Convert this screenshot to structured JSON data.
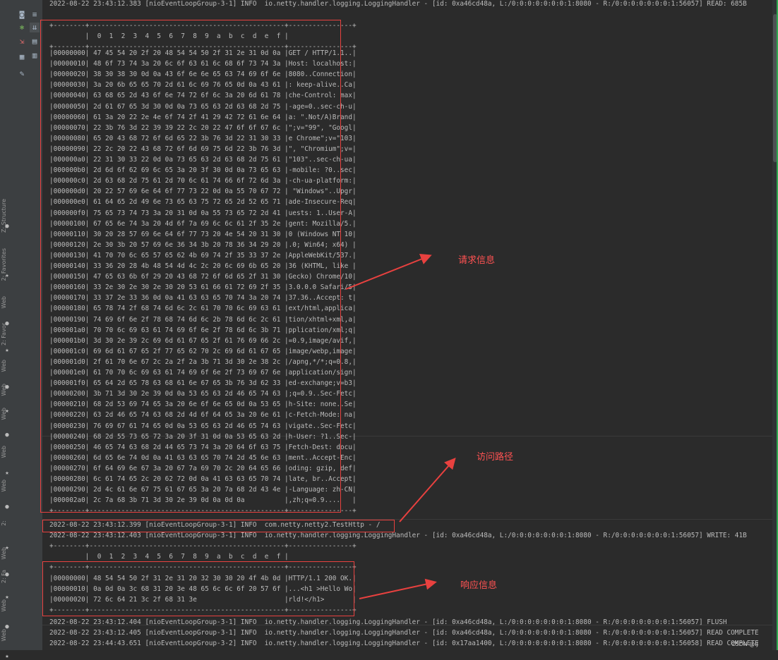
{
  "sidebar": {
    "tabs": [
      {
        "label": "Z: Structure"
      },
      {
        "label": "2: Favorites"
      },
      {
        "label": "Web"
      },
      {
        "label": "2: Favor"
      },
      {
        "label": "Web"
      },
      {
        "label": "Web"
      },
      {
        "label": "Web"
      },
      {
        "label": "Web"
      },
      {
        "label": "Web"
      },
      {
        "label": "2:"
      },
      {
        "label": "Web"
      },
      {
        "label": "2: Fa"
      },
      {
        "label": "Web"
      },
      {
        "label": "Web"
      }
    ]
  },
  "toolbar": {
    "icons": [
      "camera-icon",
      "wrap-icon",
      "settings-icon",
      "scroll-end-icon",
      "import-icon",
      "print-icon",
      "layout-icon",
      "trash-icon",
      "pin-icon"
    ]
  },
  "console": {
    "top_log": "2022-08-22 23:43:12.383 [nioEventLoopGroup-3-1] INFO  io.netty.handler.logging.LoggingHandler - [id: 0xa46cd48a, L:/0:0:0:0:0:0:0:1:8080 - R:/0:0:0:0:0:0:0:1:56057] READ: 685B",
    "hex_header": "         |  0  1  2  3  4  5  6  7  8  9  a  b  c  d  e  f |",
    "hex_border": "+--------+-------------------------------------------------+----------------+",
    "request_rows": [
      "|00000000| 47 45 54 20 2f 20 48 54 54 50 2f 31 2e 31 0d 0a |GET / HTTP/1.1..|",
      "|00000010| 48 6f 73 74 3a 20 6c 6f 63 61 6c 68 6f 73 74 3a |Host: localhost:|",
      "|00000020| 38 30 38 30 0d 0a 43 6f 6e 6e 65 63 74 69 6f 6e |8080..Connection|",
      "|00000030| 3a 20 6b 65 65 70 2d 61 6c 69 76 65 0d 0a 43 61 |: keep-alive..Ca|",
      "|00000040| 63 68 65 2d 43 6f 6e 74 72 6f 6c 3a 20 6d 61 78 |che-Control: max|",
      "|00000050| 2d 61 67 65 3d 30 0d 0a 73 65 63 2d 63 68 2d 75 |-age=0..sec-ch-u|",
      "|00000060| 61 3a 20 22 2e 4e 6f 74 2f 41 29 42 72 61 6e 64 |a: \".Not/A)Brand|",
      "|00000070| 22 3b 76 3d 22 39 39 22 2c 20 22 47 6f 6f 67 6c |\";v=\"99\", \"Googl|",
      "|00000080| 65 20 43 68 72 6f 6d 65 22 3b 76 3d 22 31 30 33 |e Chrome\";v=\"103|",
      "|00000090| 22 2c 20 22 43 68 72 6f 6d 69 75 6d 22 3b 76 3d |\", \"Chromium\";v=|",
      "|000000a0| 22 31 30 33 22 0d 0a 73 65 63 2d 63 68 2d 75 61 |\"103\"..sec-ch-ua|",
      "|000000b0| 2d 6d 6f 62 69 6c 65 3a 20 3f 30 0d 0a 73 65 63 |-mobile: ?0..sec|",
      "|000000c0| 2d 63 68 2d 75 61 2d 70 6c 61 74 66 6f 72 6d 3a |-ch-ua-platform:|",
      "|000000d0| 20 22 57 69 6e 64 6f 77 73 22 0d 0a 55 70 67 72 | \"Windows\"..Upgr|",
      "|000000e0| 61 64 65 2d 49 6e 73 65 63 75 72 65 2d 52 65 71 |ade-Insecure-Req|",
      "|000000f0| 75 65 73 74 73 3a 20 31 0d 0a 55 73 65 72 2d 41 |uests: 1..User-A|",
      "|00000100| 67 65 6e 74 3a 20 4d 6f 7a 69 6c 6c 61 2f 35 2e |gent: Mozilla/5.|",
      "|00000110| 30 20 28 57 69 6e 64 6f 77 73 20 4e 54 20 31 30 |0 (Windows NT 10|",
      "|00000120| 2e 30 3b 20 57 69 6e 36 34 3b 20 78 36 34 29 20 |.0; Win64; x64) |",
      "|00000130| 41 70 70 6c 65 57 65 62 4b 69 74 2f 35 33 37 2e |AppleWebKit/537.|",
      "|00000140| 33 36 20 28 4b 48 54 4d 4c 2c 20 6c 69 6b 65 20 |36 (KHTML, like |",
      "|00000150| 47 65 63 6b 6f 29 20 43 68 72 6f 6d 65 2f 31 30 |Gecko) Chrome/10|",
      "|00000160| 33 2e 30 2e 30 2e 30 20 53 61 66 61 72 69 2f 35 |3.0.0.0 Safari/5|",
      "|00000170| 33 37 2e 33 36 0d 0a 41 63 63 65 70 74 3a 20 74 |37.36..Accept: t|",
      "|00000180| 65 78 74 2f 68 74 6d 6c 2c 61 70 70 6c 69 63 61 |ext/html,applica|",
      "|00000190| 74 69 6f 6e 2f 78 68 74 6d 6c 2b 78 6d 6c 2c 61 |tion/xhtml+xml,a|",
      "|000001a0| 70 70 6c 69 63 61 74 69 6f 6e 2f 78 6d 6c 3b 71 |pplication/xml;q|",
      "|000001b0| 3d 30 2e 39 2c 69 6d 61 67 65 2f 61 76 69 66 2c |=0.9,image/avif,|",
      "|000001c0| 69 6d 61 67 65 2f 77 65 62 70 2c 69 6d 61 67 65 |image/webp,image|",
      "|000001d0| 2f 61 70 6e 67 2c 2a 2f 2a 3b 71 3d 30 2e 38 2c |/apng,*/*;q=0.8,|",
      "|000001e0| 61 70 70 6c 69 63 61 74 69 6f 6e 2f 73 69 67 6e |application/sign|",
      "|000001f0| 65 64 2d 65 78 63 68 61 6e 67 65 3b 76 3d 62 33 |ed-exchange;v=b3|",
      "|00000200| 3b 71 3d 30 2e 39 0d 0a 53 65 63 2d 46 65 74 63 |;q=0.9..Sec-Fetc|",
      "|00000210| 68 2d 53 69 74 65 3a 20 6e 6f 6e 65 0d 0a 53 65 |h-Site: none..Se|",
      "|00000220| 63 2d 46 65 74 63 68 2d 4d 6f 64 65 3a 20 6e 61 |c-Fetch-Mode: na|",
      "|00000230| 76 69 67 61 74 65 0d 0a 53 65 63 2d 46 65 74 63 |vigate..Sec-Fetc|",
      "|00000240| 68 2d 55 73 65 72 3a 20 3f 31 0d 0a 53 65 63 2d |h-User: ?1..Sec-|",
      "|00000250| 46 65 74 63 68 2d 44 65 73 74 3a 20 64 6f 63 75 |Fetch-Dest: docu|",
      "|00000260| 6d 65 6e 74 0d 0a 41 63 63 65 70 74 2d 45 6e 63 |ment..Accept-Enc|",
      "|00000270| 6f 64 69 6e 67 3a 20 67 7a 69 70 2c 20 64 65 66 |oding: gzip, def|",
      "|00000280| 6c 61 74 65 2c 20 62 72 0d 0a 41 63 63 65 70 74 |late, br..Accept|",
      "|00000290| 2d 4c 61 6e 67 75 61 67 65 3a 20 7a 68 2d 43 4e |-Language: zh-CN|",
      "|000002a0| 2c 7a 68 3b 71 3d 30 2e 39 0d 0a 0d 0a          |,zh;q=0.9....   |"
    ],
    "path_log": "2022-08-22 23:43:12.399 [nioEventLoopGroup-3-1] INFO  com.netty.netty2.TestHttp - /",
    "write_log": "2022-08-22 23:43:12.403 [nioEventLoopGroup-3-1] INFO  io.netty.handler.logging.LoggingHandler - [id: 0xa46cd48a, L:/0:0:0:0:0:0:0:1:8080 - R:/0:0:0:0:0:0:0:1:56057] WRITE: 41B",
    "response_rows": [
      "|00000000| 48 54 54 50 2f 31 2e 31 20 32 30 30 20 4f 4b 0d |HTTP/1.1 200 OK.|",
      "|00000010| 0a 0d 0a 3c 68 31 20 3e 48 65 6c 6c 6f 20 57 6f |...<h1 >Hello Wo|",
      "|00000020| 72 6c 64 21 3c 2f 68 31 3e                      |rld!</h1>       |"
    ],
    "bottom_logs": [
      "2022-08-22 23:43:12.404 [nioEventLoopGroup-3-1] INFO  io.netty.handler.logging.LoggingHandler - [id: 0xa46cd48a, L:/0:0:0:0:0:0:0:1:8080 - R:/0:0:0:0:0:0:0:1:56057] FLUSH",
      "2022-08-22 23:43:12.405 [nioEventLoopGroup-3-1] INFO  io.netty.handler.logging.LoggingHandler - [id: 0xa46cd48a, L:/0:0:0:0:0:0:0:1:8080 - R:/0:0:0:0:0:0:0:1:56057] READ COMPLETE",
      "2022-08-22 23:44:43.651 [nioEventLoopGroup-3-2] INFO  io.netty.handler.logging.LoggingHandler - [id: 0x17aa1400, L:/0:0:0:0:0:0:0:1:8080 - R:/0:0:0:0:0:0:0:1:56058] READ COMPLETE"
    ]
  },
  "annotations": {
    "request": "请求信息",
    "path": "访问路径",
    "response": "响应信息"
  },
  "watermark": "CSDN @IJ",
  "colors": {
    "annotation_red": "#e8413f",
    "console_bg": "#2b2b2b",
    "text": "#bbbbbb"
  }
}
